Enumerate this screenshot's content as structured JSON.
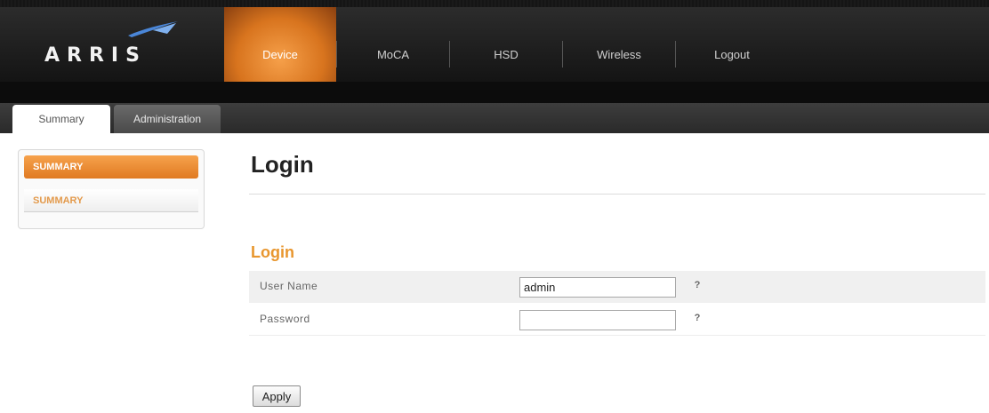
{
  "brand": {
    "logo_text": "ARRIS"
  },
  "nav": {
    "items": [
      {
        "label": "Device"
      },
      {
        "label": "MoCA"
      },
      {
        "label": "HSD"
      },
      {
        "label": "Wireless"
      },
      {
        "label": "Logout"
      }
    ]
  },
  "subtabs": [
    {
      "label": "Summary"
    },
    {
      "label": "Administration"
    }
  ],
  "sidebar": {
    "items": [
      {
        "label": "SUMMARY"
      },
      {
        "label": "SUMMARY"
      }
    ]
  },
  "main": {
    "page_title": "Login",
    "section_title": "Login",
    "fields": [
      {
        "label": "User Name",
        "value": "admin",
        "help": "?"
      },
      {
        "label": "Password",
        "value": "",
        "help": "?"
      }
    ],
    "apply_label": "Apply"
  },
  "colors": {
    "accent": "#e8962e",
    "header_bg": "#181818"
  }
}
